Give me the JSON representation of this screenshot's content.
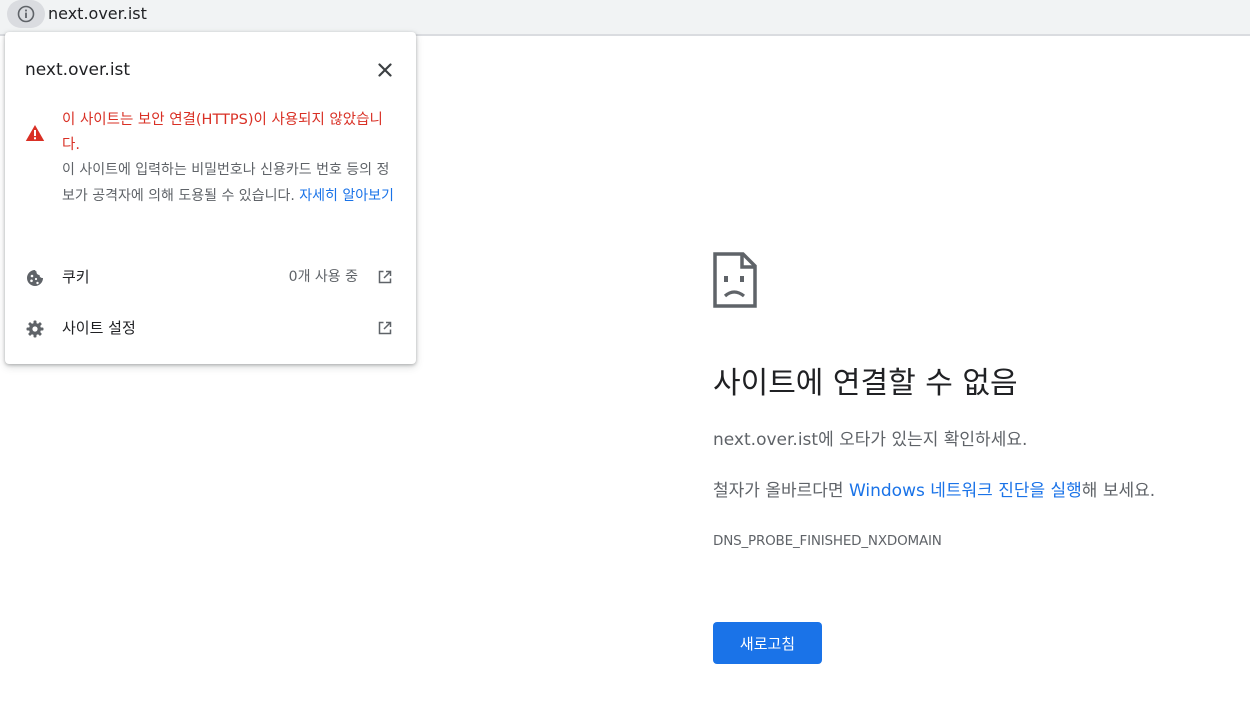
{
  "omnibox": {
    "url": "next.over.ist",
    "site_info_icon": "info-circle-icon"
  },
  "popup": {
    "host": "next.over.ist",
    "close_icon": "close-icon",
    "warning": {
      "icon": "warning-triangle-icon",
      "color": "#d93025",
      "title": "이 사이트는 보안 연결(HTTPS)이 사용되지 않았습니다.",
      "body": "이 사이트에 입력하는 비밀번호나 신용카드 번호 등의 정보가 공격자에 의해 도용될 수 있습니다.",
      "learn_more": "자세히 알아보기"
    },
    "cookies": {
      "icon": "cookie-icon",
      "label": "쿠키",
      "value": "0개 사용 중",
      "ext_icon": "open-in-new-icon"
    },
    "site_settings": {
      "icon": "gear-icon",
      "label": "사이트 설정",
      "ext_icon": "open-in-new-icon"
    }
  },
  "error_page": {
    "icon": "sad-page-icon",
    "title": "사이트에 연결할 수 없음",
    "line1_host": "next.over.ist",
    "line1_rest": "에 오타가 있는지 확인하세요.",
    "line2_prefix": "철자가 올바르다면 ",
    "line2_link": "Windows 네트워크 진단을 실행",
    "line2_suffix": "해 보세요.",
    "error_code": "DNS_PROBE_FINISHED_NXDOMAIN",
    "reload_label": "새로고침",
    "accent_color": "#1a73e8"
  }
}
